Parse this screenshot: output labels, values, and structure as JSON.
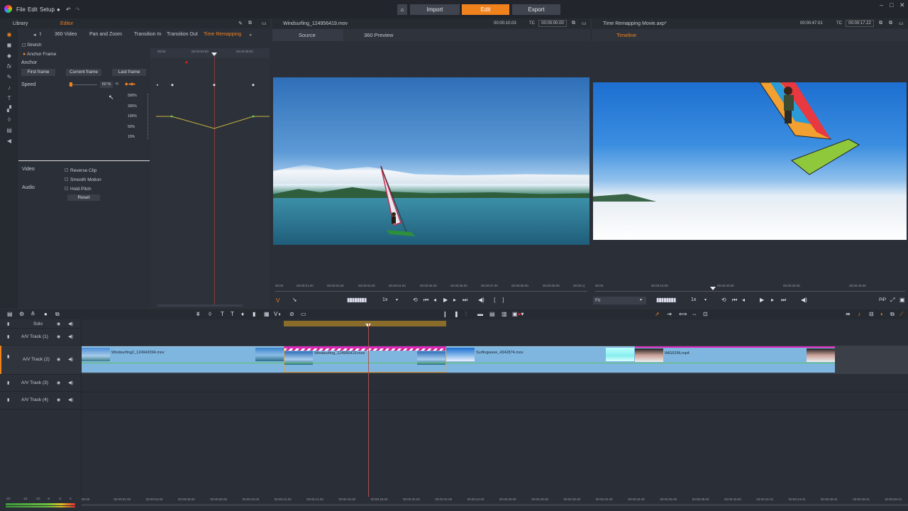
{
  "menu": {
    "file": "File",
    "edit": "Edit",
    "setup": "Setup",
    "modes": [
      "Import",
      "Edit",
      "Export"
    ],
    "active_mode": "Edit"
  },
  "left_panel": {
    "tabs": [
      "Library",
      "Editor"
    ],
    "sub_tabs": [
      "t",
      "360 Video",
      "Pan and Zoom",
      "Transition In",
      "Transition Out",
      "Time Remapping"
    ],
    "active_sub_tab": "Time Remapping",
    "stretch": "Stretch",
    "anchor_frame": "Anchor Frame",
    "anchor_label": "Anchor",
    "anchor_buttons": [
      "First frame",
      "Current frame",
      "Last frame"
    ],
    "speed_label": "Speed",
    "speed_value": "50 %",
    "ruler_ticks": [
      "00:00",
      "00:00:04:00",
      "00:00:08:00"
    ],
    "speed_scale": [
      "500%",
      "300%",
      "100%",
      "50%",
      "10%"
    ],
    "video_label": "Video",
    "audio_label": "Audio",
    "options": [
      "Reverse Clip",
      "Smooth Motion",
      "Hold Pitch"
    ],
    "reset": "Reset"
  },
  "source_panel": {
    "filename": "Windsurfing_124956419.mov",
    "timecode_1": "00:00:10.03",
    "tc_label": "TC",
    "timecode_2": "00:00:00.00",
    "tabs": [
      "Source",
      "360 Preview"
    ],
    "ruler_ticks": [
      "00:00",
      "00:00:01.00",
      "00:00:02.00",
      "00:00:03.00",
      "00:00:04.00",
      "00:00:05.00",
      "00:00:06.00",
      "00:00:07.00",
      "00:00:08.00",
      "00:00:09.00",
      "00:00:1("
    ],
    "speed": "1x",
    "mark": "V"
  },
  "timeline_panel": {
    "filename": "Time Remapping Movie.axp*",
    "timecode_1": "00:00:47.01",
    "tc_label": "TC",
    "timecode_2": "00:00:17.22",
    "tab": "Timeline",
    "ruler_ticks": [
      "00:00",
      "00:00:10.00",
      "00:00:20.00",
      "00:00:30.00",
      "00:00:40.00"
    ],
    "speed": "1x",
    "fit": "Fit",
    "pip": "PiP"
  },
  "timeline": {
    "solo": "Solo",
    "tracks": [
      "A/V Track (1)",
      "A/V Track (2)",
      "A/V Track (3)",
      "A/V Track (4)"
    ],
    "clips": [
      "Windsurfing2_124942094.mov",
      "Windsurfing_124956419.mov",
      "Surfingwave_4342874.mov",
      "IMG6296.mp4"
    ],
    "ruler_ticks": [
      "00:00",
      "00:00:02.00",
      "00:00:04.00",
      "00:00:06.00",
      "00:00:08.00",
      "00:00:10.00",
      "00:00:12.00",
      "00:00:14.00",
      "00:00:16.00",
      "00:00:18.00",
      "00:00:20.00",
      "00:00:22.00",
      "00:00:24.00",
      "00:00:26.00",
      "00:00:28.00",
      "00:00:30.00",
      "00:00:32.00",
      "00:00:34.00",
      "00:00:36.00",
      "00:00:38.00",
      "00:00:40.00",
      "00:00:42.01",
      "00:00:44.01",
      "00:00:46.01",
      "00:00:48.01",
      "00:00:50.01"
    ],
    "meter_ticks": [
      "-22",
      "-16",
      "-10",
      "-6",
      "-3",
      "0"
    ]
  },
  "colors": {
    "accent": "#f0821e",
    "clip_blue": "#7fb6df",
    "selection_pink": "#e028c0",
    "range_bar": "#8a6d2a",
    "speed_curve": "#c8b43c"
  }
}
